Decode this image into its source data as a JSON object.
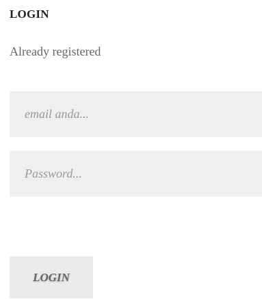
{
  "login": {
    "title": "LOGIN",
    "subtitle": "Already registered",
    "email": {
      "value": "",
      "placeholder": "email anda..."
    },
    "password": {
      "value": "",
      "placeholder": "Password..."
    },
    "submit_label": "LOGIN"
  },
  "colors": {
    "field_background": "#efefef",
    "button_background": "#ebebeb",
    "title_text": "#222222",
    "subtitle_text": "#666666",
    "placeholder_text": "#9a9a9a"
  }
}
